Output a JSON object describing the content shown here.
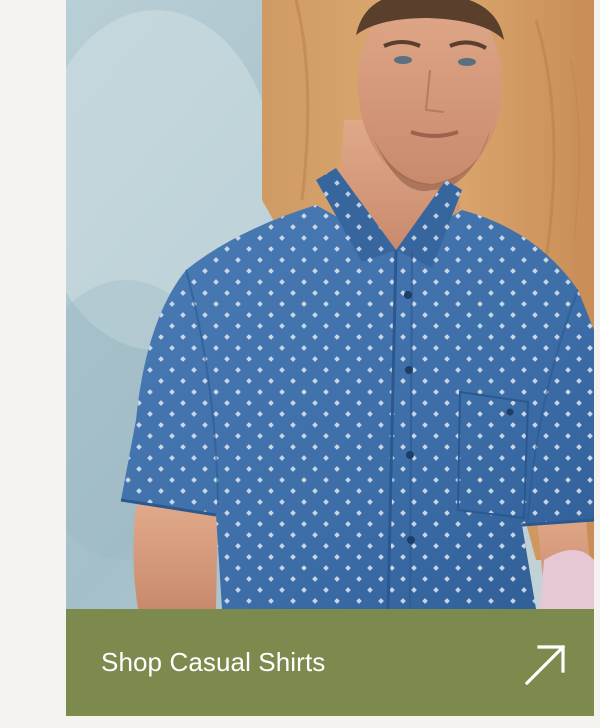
{
  "promo_card": {
    "image_alt": "Man wearing a short-sleeve blue denim shirt with a small white diamond print",
    "cta_label": "Shop Casual Shirts",
    "cta_icon": "arrow-up-right-icon",
    "cta_color": "#7c8a4e"
  }
}
